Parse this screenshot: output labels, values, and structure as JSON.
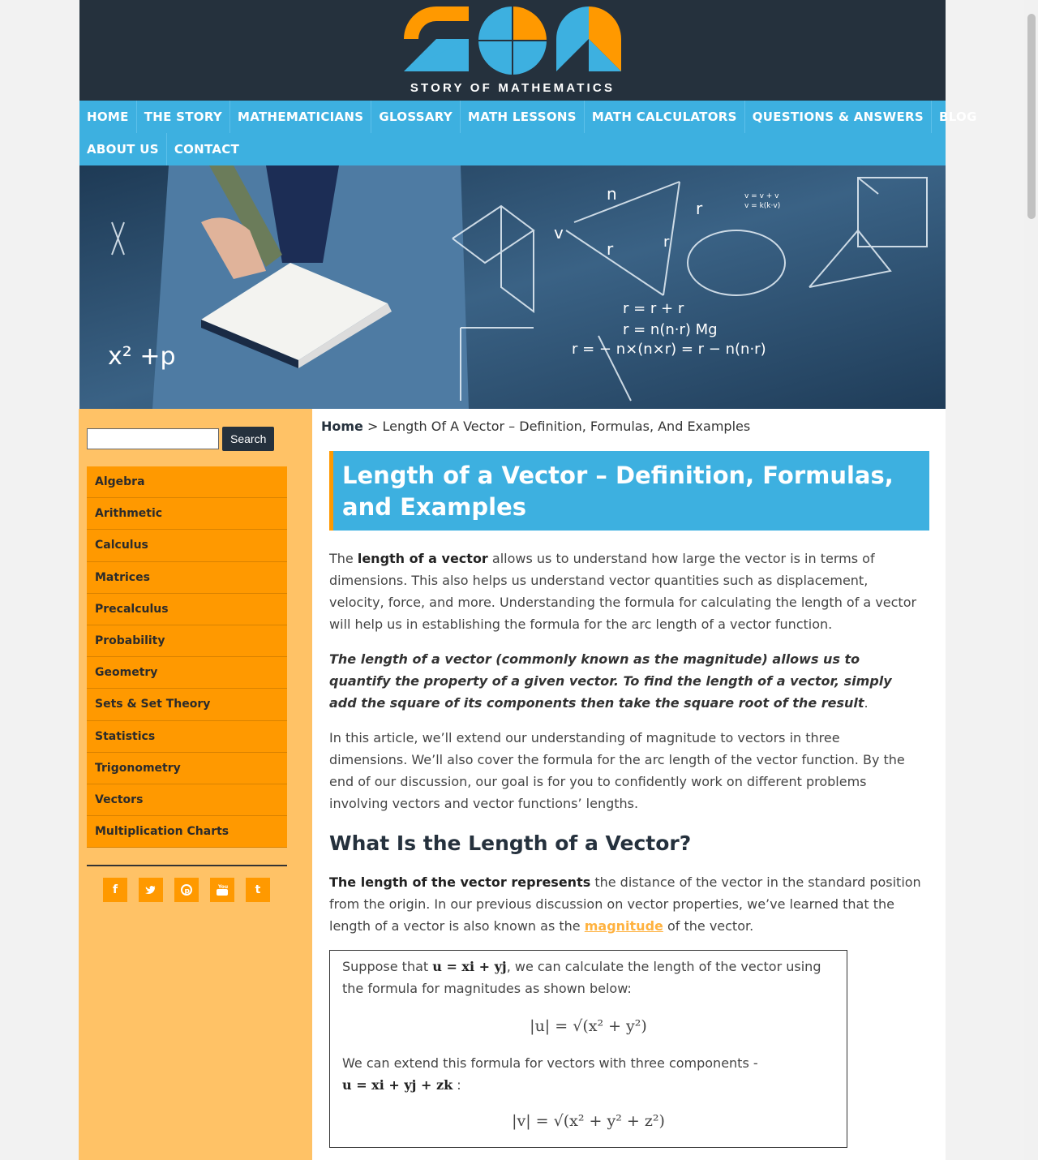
{
  "logo": {
    "text": "STORY OF MATHEMATICS"
  },
  "nav": {
    "row1": [
      "HOME",
      "THE STORY",
      "MATHEMATICIANS",
      "GLOSSARY",
      "MATH LESSONS",
      "MATH CALCULATORS",
      "QUESTIONS & ANSWERS",
      "BLOG"
    ],
    "row2": [
      "ABOUT US",
      "CONTACT"
    ]
  },
  "sidebar": {
    "search_button": "Search",
    "categories": [
      "Algebra",
      "Arithmetic",
      "Calculus",
      "Matrices",
      "Precalculus",
      "Probability",
      "Geometry",
      "Sets & Set Theory",
      "Statistics",
      "Trigonometry",
      "Vectors",
      "Multiplication Charts"
    ],
    "social_icons": [
      "facebook-icon",
      "twitter-icon",
      "pinterest-icon",
      "youtube-icon",
      "tumblr-icon"
    ]
  },
  "breadcrumb": {
    "home": "Home",
    "separator": " > ",
    "current": "Length Of A Vector – Definition, Formulas, And Examples"
  },
  "article": {
    "title": "Length of a Vector – Definition, Formulas, and Examples",
    "p1_pre": "The ",
    "p1_bold": "length of a vector",
    "p1_post": " allows us to understand how large the vector is in terms of dimensions. This also helps us understand vector quantities such as displacement, velocity, force, and more. Understanding the formula for calculating the length of a vector will help us in establishing the formula for the arc length of a vector function.",
    "p2": "The length of a vector (commonly known as the magnitude) allows us to quantify the property of a given vector. To find the length of a vector, simply add the square of its components then take the square root of the result",
    "p2_end": ".",
    "p3": "In this article, we’ll extend our understanding of magnitude to vectors in three dimensions. We’ll also cover the formula for the arc length of the vector function. By the end of our discussion, our goal is for you to confidently work on different problems involving vectors and vector functions’ lengths.",
    "h2": "What Is the Length of a Vector?",
    "p4_bold": "The length of the vector represents",
    "p4_post": " the distance of the vector in the standard position from the origin. In our previous discussion on vector properties, we’ve learned that the length of a vector is also known as the ",
    "p4_link": "magnitude",
    "p4_end": " of the vector.",
    "box_p1_pre": "Suppose that ",
    "box_p1_math": "u = xi + yj",
    "box_p1_post": ", we can calculate the length of the vector using the formula for magnitudes as shown below:",
    "box_formula1": "|u| = √(x² + y²)",
    "box_p2_pre": "We can extend this formula for vectors with three components -",
    "box_p2_math": "u = xi + yj + zk",
    "box_p2_post": " :",
    "box_formula2": "|v| = √(x² + y² + z²)"
  },
  "colors": {
    "header": "#25313d",
    "nav": "#3db0e0",
    "accent": "#ff9900",
    "sidebar": "#ffc266"
  }
}
